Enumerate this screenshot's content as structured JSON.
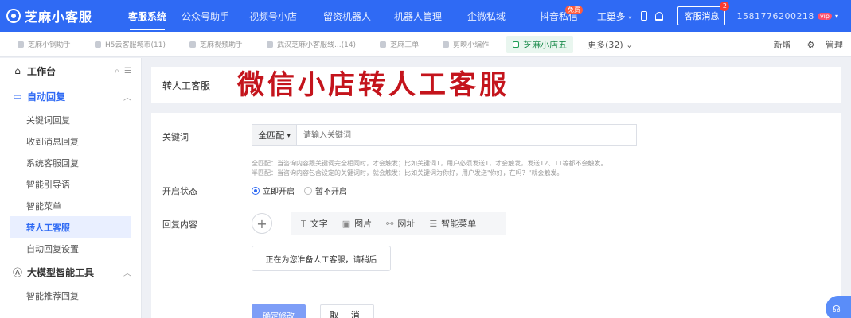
{
  "brand": {
    "name": "芝麻小客服"
  },
  "top_nav": {
    "items": [
      {
        "label": "客服系统",
        "active": true
      },
      {
        "label": "公众号助手"
      },
      {
        "label": "视频号小店"
      },
      {
        "label": "留资机器人"
      },
      {
        "label": "机器人管理"
      },
      {
        "label": "企微私域"
      },
      {
        "label": "抖音私信",
        "badge": "免费"
      },
      {
        "label": "工单"
      }
    ],
    "more_label": "更多",
    "kefu_btn": "客服消息",
    "kefu_count": "2",
    "user_id": "1581776200218",
    "vip": "vip"
  },
  "shop_tabs": {
    "items": [
      {
        "label": "芝麻小钢助手"
      },
      {
        "label": "H5云客服城市(11)"
      },
      {
        "label": "芝麻视频助手"
      },
      {
        "label": "武汉芝麻小客服线...(14)"
      },
      {
        "label": "芝麻工单"
      },
      {
        "label": "剪映小编作"
      },
      {
        "label": "芝麻小店五",
        "active": true
      }
    ],
    "more_label": "更多(32)",
    "add_label": "新增",
    "manage_label": "管理"
  },
  "sidebar": {
    "workbench": "工作台",
    "auto_reply": "自动回复",
    "auto_reply_items": [
      {
        "label": "关键词回复"
      },
      {
        "label": "收到消息回复"
      },
      {
        "label": "系统客服回复"
      },
      {
        "label": "智能引导语"
      },
      {
        "label": "智能菜单"
      },
      {
        "label": "转人工客服",
        "active": true
      },
      {
        "label": "自动回复设置"
      }
    ],
    "llm_tools": "大模型智能工具",
    "llm_items": [
      {
        "label": "智能推荐回复"
      }
    ]
  },
  "main": {
    "page_title": "转人工客服",
    "banner": "微信小店转人工客服",
    "keyword": {
      "label": "关键词",
      "match_mode": "全匹配",
      "placeholder": "请输入关键词",
      "hint_full": "全匹配：当咨询内容跟关键词完全相同时，才会触发；比如关键词1，用户必须发送1，才会触发，发送12、11等都不会触发。",
      "hint_half": "半匹配：当咨询内容包含设定的关键词时，就会触发；比如关键词为你好，用户发送\"你好，在吗？\"就会触发。"
    },
    "status": {
      "label": "开启状态",
      "options": [
        {
          "label": "立即开启",
          "checked": true
        },
        {
          "label": "暂不开启",
          "checked": false
        }
      ]
    },
    "reply": {
      "label": "回复内容",
      "types": [
        {
          "icon": "text-icon",
          "label": "文字"
        },
        {
          "icon": "image-icon",
          "label": "图片"
        },
        {
          "icon": "link-icon",
          "label": "网址"
        },
        {
          "icon": "menu-icon",
          "label": "智能菜单"
        }
      ],
      "content": "正在为您准备人工客服，请稍后"
    },
    "confirm_label": "确定修改",
    "cancel_label": "取 消"
  }
}
